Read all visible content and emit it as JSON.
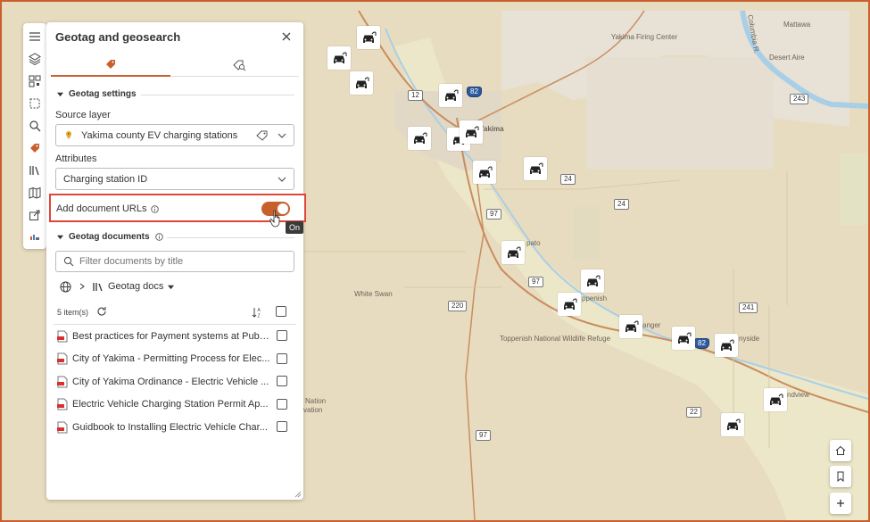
{
  "panel": {
    "title": "Geotag and geosearch",
    "tabs": [
      {
        "icon": "tag-icon",
        "active": true
      },
      {
        "icon": "tag-search-icon",
        "active": false
      }
    ]
  },
  "geotag_settings": {
    "heading": "Geotag settings",
    "source_layer_label": "Source layer",
    "source_layer_value": "Yakima county EV charging stations",
    "attributes_label": "Attributes",
    "attributes_value": "Charging station ID",
    "add_urls_label": "Add document URLs",
    "add_urls_state": "on",
    "tooltip": "On"
  },
  "geotag_documents": {
    "heading": "Geotag documents",
    "filter_placeholder": "Filter documents by title",
    "breadcrumb_folder": "Geotag docs",
    "item_count": "5 item(s)",
    "documents": [
      {
        "title": "Best practices for Payment systems at Publi..."
      },
      {
        "title": "City of Yakima - Permitting Process for Elec..."
      },
      {
        "title": "City of Yakima Ordinance - Electric Vehicle ..."
      },
      {
        "title": "Electric Vehicle Charging Station Permit Ap..."
      },
      {
        "title": "Guidbook to Installing Electric Vehicle Char..."
      }
    ]
  },
  "map": {
    "labels": {
      "firing_center": "Yakima Firing Center",
      "mattawa": "Mattawa",
      "desert_aire": "Desert Aire",
      "yakima": "Yakima",
      "white_swan": "White Swan",
      "toppenish_refuge": "Toppenish National Wildlife Refuge",
      "nation": "Nation",
      "reservation": "vation",
      "topenish": "ppenish",
      "wapato": "pato",
      "granger": "anger",
      "sunnyside": "nyside",
      "grandview": "ndview",
      "columbia": "Columbia R."
    },
    "shields": {
      "r12": "12",
      "r82a": "82",
      "r24a": "24",
      "r24b": "24",
      "r97a": "97",
      "r97b": "97",
      "r97c": "97",
      "r220": "220",
      "r241": "241",
      "r243": "243",
      "r82b": "82",
      "r22": "22"
    }
  },
  "colors": {
    "accent": "#c8602e",
    "highlight": "#e0453a",
    "interstate": "#2c5aa0"
  }
}
